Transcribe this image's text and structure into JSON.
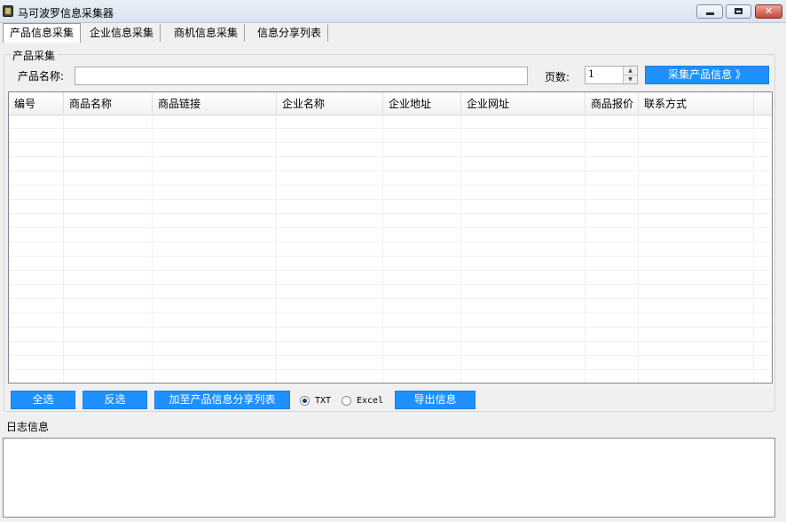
{
  "window": {
    "title": "马可波罗信息采集器"
  },
  "tabs": [
    {
      "label": "产品信息采集",
      "active": true
    },
    {
      "label": "企业信息采集",
      "active": false
    },
    {
      "label": "商机信息采集",
      "active": false
    },
    {
      "label": "信息分享列表",
      "active": false
    }
  ],
  "product": {
    "group_title": "产品采集",
    "name_label": "产品名称:",
    "name_value": "",
    "pages_label": "页数:",
    "pages_value": "1",
    "collect_button": "采集产品信息 》"
  },
  "table": {
    "columns": [
      "编号",
      "商品名称",
      "商品链接",
      "企业名称",
      "企业地址",
      "企业网址",
      "商品报价",
      "联系方式"
    ],
    "rows": []
  },
  "actions": {
    "select_all": "全选",
    "invert": "反选",
    "add_share": "加至产品信息分享列表",
    "format_txt": "TXT",
    "format_excel": "Excel",
    "format_selected": "TXT",
    "export": "导出信息"
  },
  "log": {
    "title": "日志信息",
    "content": ""
  },
  "colors": {
    "accent": "#1e90ff"
  }
}
